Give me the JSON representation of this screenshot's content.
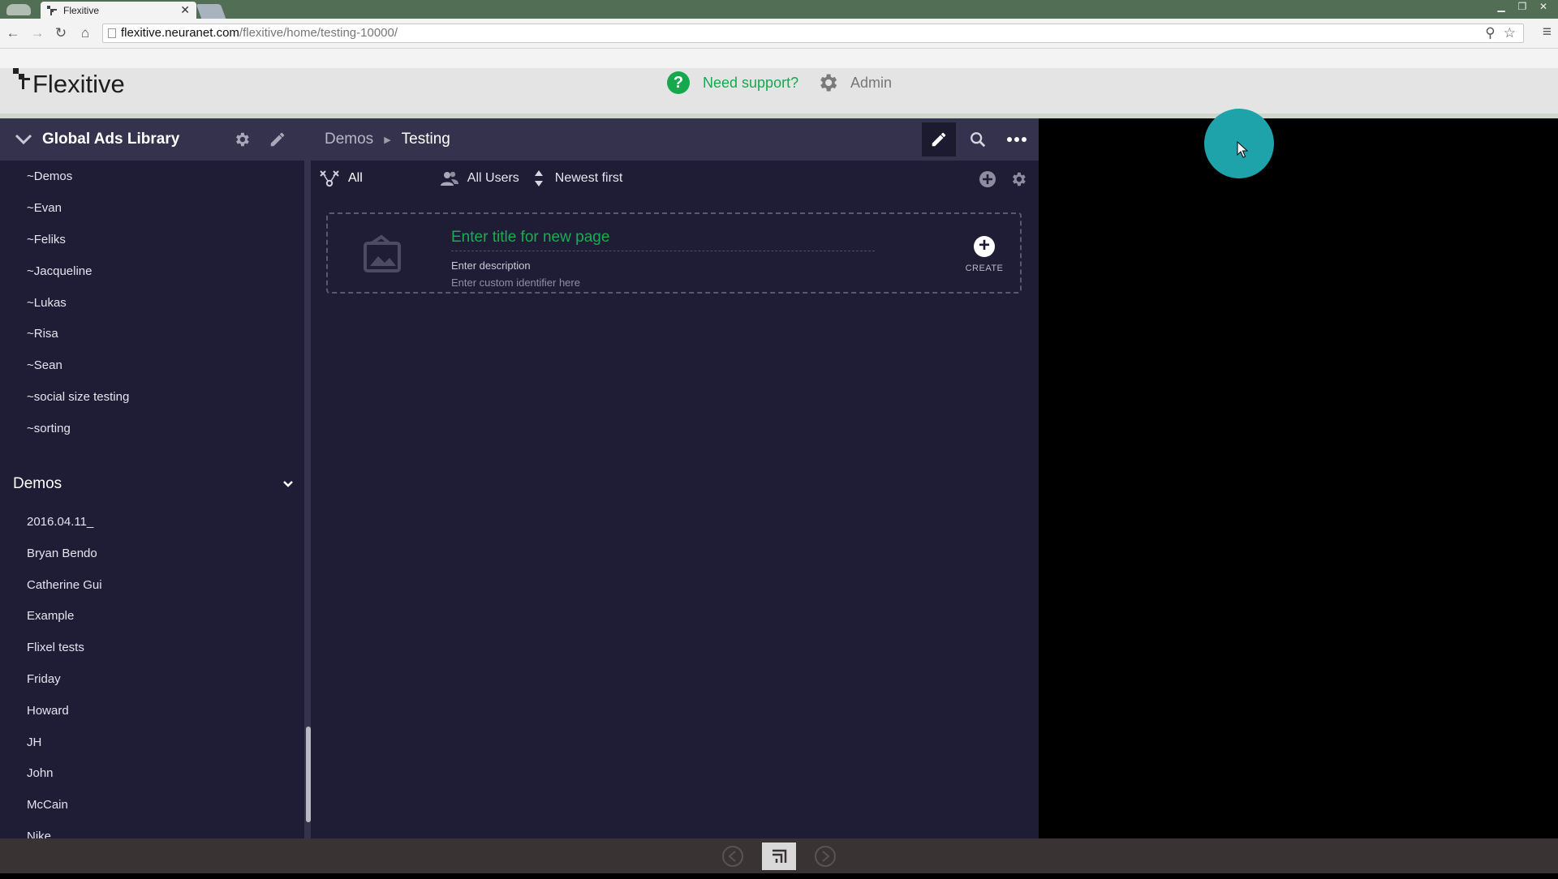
{
  "browser": {
    "tab_title": "Flexitive",
    "url_host": "flexitive.neuranet.com",
    "url_path": "/flexitive/home/testing-10000/"
  },
  "header": {
    "logo_text": "Flexitive",
    "support_label": "Need support?",
    "admin_label": "Admin"
  },
  "sidebar": {
    "library_title": "Global Ads Library",
    "library_items": [
      "~Demos",
      "~Evan",
      "~Feliks",
      "~Jacqueline",
      "~Lukas",
      "~Risa",
      "~Sean",
      "~social size testing",
      "~sorting"
    ],
    "section_title": "Demos",
    "section_items": [
      "2016.04.11_",
      "Bryan Bendo",
      "Catherine Gui",
      "Example",
      "Flixel tests",
      "Friday",
      "Howard",
      "JH",
      "John",
      "McCain",
      "Nike"
    ]
  },
  "main": {
    "breadcrumb_parent": "Demos",
    "breadcrumb_current": "Testing",
    "filter_all": "All",
    "filter_users": "All Users",
    "sort_label": "Newest first",
    "new_page": {
      "title_placeholder": "Enter title for new page",
      "description_placeholder": "Enter description",
      "identifier_placeholder": "Enter custom identifier here",
      "create_label": "CREATE"
    }
  },
  "colors": {
    "accent_green": "#17a84f",
    "panel_bg": "#1f1d36",
    "panel_header": "#35324d",
    "cursor_halo": "#1fa3ab"
  }
}
